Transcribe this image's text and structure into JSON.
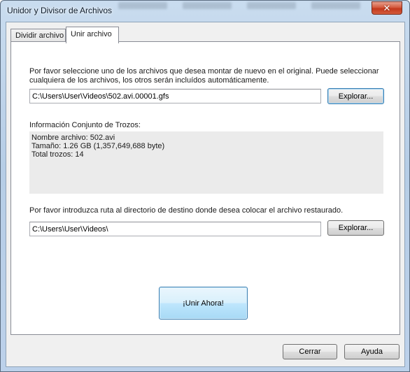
{
  "window": {
    "title": "Unidor y Divisor de Archivos",
    "close_glyph": "✕"
  },
  "tabs": [
    {
      "label": "Dividir archivo",
      "active": false
    },
    {
      "label": "Unir archivo",
      "active": true
    }
  ],
  "join_panel": {
    "instructions": "Por favor seleccione uno de los archivos que desea montar de nuevo en el original. Puede seleccionar cualquiera de los archivos, los otros serán incluídos automáticamente.",
    "source_path": "C:\\Users\\User\\Videos\\502.avi.00001.gfs",
    "browse_label": "Explorar...",
    "info_title": "Información Conjunto de Trozos:",
    "info_lines": [
      "Nombre archivo: 502.avi",
      "Tamaño: 1.26 GB (1,357,649,688 byte)",
      "Total trozos: 14"
    ],
    "dest_instructions": "Por favor introduzca ruta al directorio de destino donde desea colocar el archivo restaurado.",
    "dest_path": "C:\\Users\\User\\Videos\\",
    "dest_browse_label": "Explorar...",
    "join_now_label": "¡Unir Ahora!"
  },
  "footer": {
    "close_label": "Cerrar",
    "help_label": "Ayuda"
  }
}
